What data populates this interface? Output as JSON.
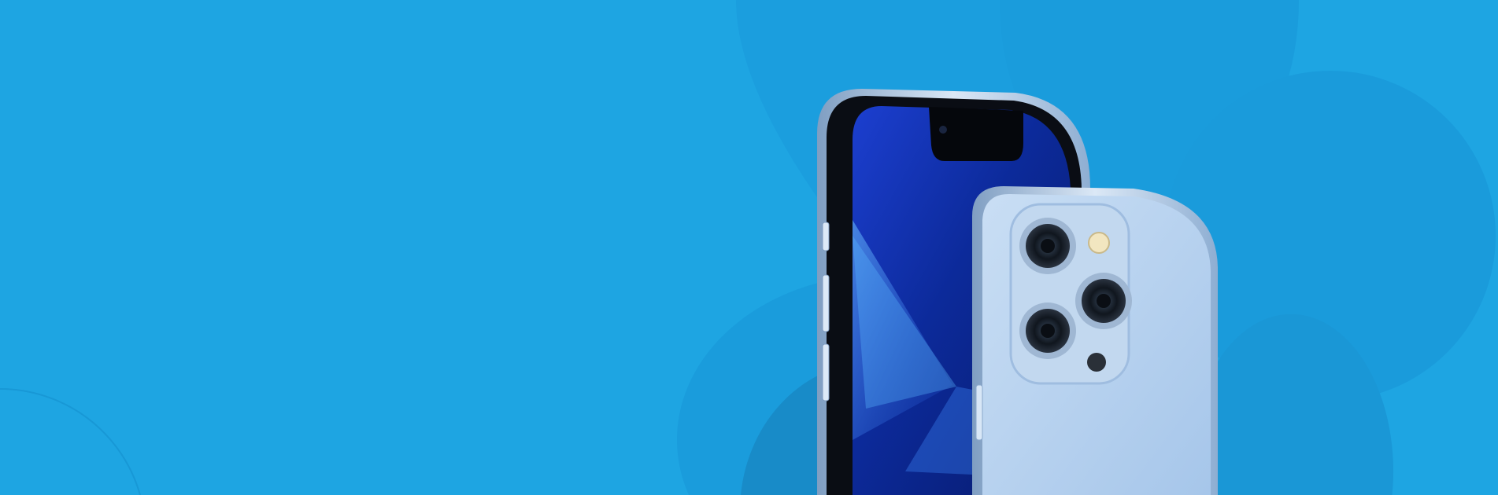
{
  "banner": {
    "image": "iphone-pro-sierra-blue-product-hero",
    "colors": {
      "background": "#1ea5e2",
      "background_shape": "#1a9cdc",
      "background_shape_dark": "#188bc8",
      "phone_frame": "#a9c6e4",
      "phone_back": "#b8d4f0",
      "screen": "#0d2fa8"
    }
  }
}
